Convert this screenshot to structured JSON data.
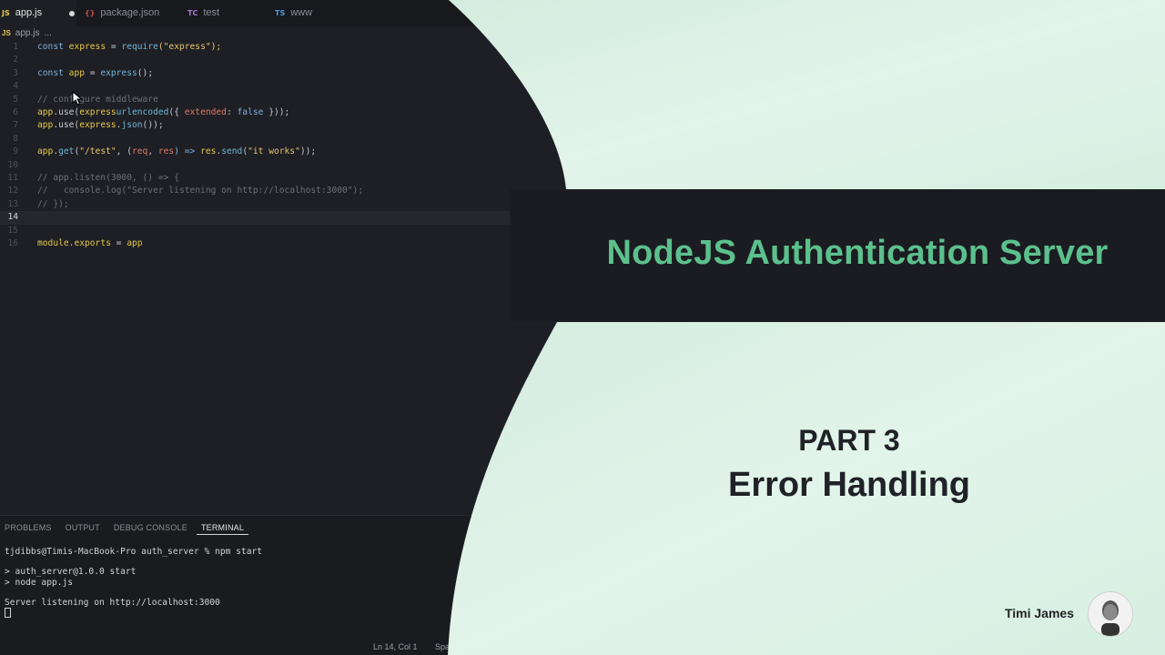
{
  "tabs": [
    {
      "icon": "JS",
      "label": "app.js",
      "active": true,
      "modified": true
    },
    {
      "icon": "{}",
      "label": "package.json",
      "active": false
    },
    {
      "icon": "TC",
      "label": "test",
      "active": false
    },
    {
      "icon": "TS",
      "label": "www",
      "active": false
    }
  ],
  "breadcrumb": {
    "icon": "JS",
    "file": "app.js",
    "rest": "..."
  },
  "line_numbers": [
    "1",
    "2",
    "3",
    "4",
    "5",
    "6",
    "7",
    "8",
    "9",
    "10",
    "11",
    "12",
    "13",
    "14",
    "15",
    "16"
  ],
  "code": {
    "l1": {
      "kw": "const",
      "name": "express",
      "eq": " = ",
      "fn": "require",
      "str": "(\"express\");"
    },
    "l3": {
      "kw": "const",
      "name": "app",
      "eq": " = ",
      "fn": "express",
      "rest": "();"
    },
    "l5": "// configure middleware",
    "l6": {
      "obj": "app",
      "m": ".use(",
      "obj2": "express",
      ".": ".",
      "fn": "urlencoded",
      "open": "({ ",
      "key": "extended",
      "colon": ": ",
      "val": "false",
      "close": " }));"
    },
    "l7": {
      "obj": "app",
      "m": ".use(",
      "obj2": "express",
      "dot": ".",
      "fn": "json",
      "close": "());"
    },
    "l9": {
      "obj": "app",
      "dot": ".",
      "fn": "get",
      "open": "(",
      "str": "\"/test\"",
      "comma": ", (",
      "a1": "req",
      "c2": ", ",
      "a2": "res",
      "arrow": ") => ",
      "obj3": "res",
      "dot2": ".",
      "fn2": "send",
      "open2": "(",
      "str2": "\"it works\"",
      "close": "));"
    },
    "l11": "// app.listen(3000, () => {",
    "l12": "//   console.log(\"Server listening on http://localhost:3000\");",
    "l13": "// });",
    "l16": {
      "kw": "module",
      "dot": ".",
      "name": "exports",
      "eq": " = ",
      "obj": "app"
    }
  },
  "panel": {
    "tabs": [
      "PROBLEMS",
      "OUTPUT",
      "DEBUG CONSOLE",
      "TERMINAL"
    ],
    "active_tab": "TERMINAL"
  },
  "terminal": {
    "line1": "tjdibbs@Timis-MacBook-Pro auth_server % npm start",
    "line2": "> auth_server@1.0.0 start",
    "line3": "> node app.js",
    "line4": "Server listening on http://localhost:3000"
  },
  "status": {
    "position": "Ln 14, Col 1",
    "spaces": "Spa"
  },
  "overlay": {
    "title": "NodeJS Authentication Server",
    "part": "PART 3",
    "topic": "Error Handling",
    "author": "Timi James"
  },
  "colors": {
    "accent": "#5cc08d",
    "mint": "#d8efe3",
    "banner": "#1b1c21"
  }
}
